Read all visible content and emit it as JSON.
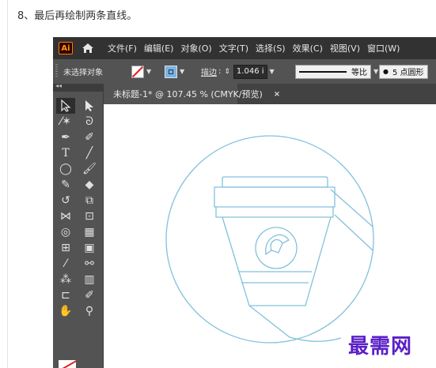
{
  "instruction": "8、最后再绘制两条直线。",
  "app": {
    "logo_text": "Ai"
  },
  "menu": [
    "文件(F)",
    "编辑(E)",
    "对象(O)",
    "文字(T)",
    "选择(S)",
    "效果(C)",
    "视图(V)",
    "窗口(W)"
  ],
  "control_bar": {
    "selection_status": "未选择对象",
    "stroke_label": "描边",
    "stroke_weight": "1.046 i",
    "profile_label": "等比",
    "brush_label": "5 点圆形"
  },
  "document_tab": {
    "title": "未标题-1* @ 107.45 % (CMYK/预览)",
    "close": "×"
  },
  "watermark": "最需网",
  "colors": {
    "artwork_stroke": "#82c1dc",
    "watermark": "#5a1fc7",
    "menu_bg": "#323232",
    "panel_bg": "#535353"
  },
  "tools": [
    "selection-tool",
    "direct-selection-tool",
    "magic-wand-tool",
    "lasso-tool",
    "pen-tool",
    "curvature-tool",
    "type-tool",
    "line-segment-tool",
    "ellipse-tool",
    "paintbrush-tool",
    "shaper-tool",
    "eraser-tool",
    "rotate-tool",
    "scale-tool",
    "width-tool",
    "free-transform-tool",
    "shape-builder-tool",
    "perspective-grid-tool",
    "mesh-tool",
    "gradient-tool",
    "eyedropper-tool",
    "blend-tool",
    "symbol-sprayer-tool",
    "column-graph-tool",
    "artboard-tool",
    "slice-tool",
    "hand-tool",
    "zoom-tool"
  ]
}
